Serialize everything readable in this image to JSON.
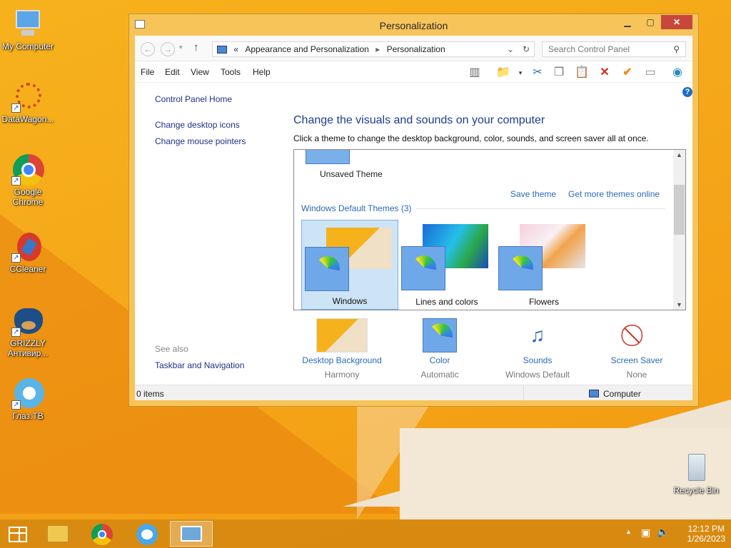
{
  "desktop": {
    "icons": [
      {
        "label": "My Computer"
      },
      {
        "label": "DataWagon..."
      },
      {
        "label": "Google Chrome"
      },
      {
        "label": "CCleaner"
      },
      {
        "label": "GRIZZLY Антивир..."
      },
      {
        "label": "Глаз.ТВ"
      },
      {
        "label": "Recycle Bin"
      }
    ]
  },
  "window": {
    "title": "Personalization",
    "breadcrumb": {
      "prefix": "«",
      "items": [
        "Appearance and Personalization",
        "Personalization"
      ]
    },
    "search_placeholder": "Search Control Panel",
    "menu": [
      "File",
      "Edit",
      "View",
      "Tools",
      "Help"
    ],
    "left_pane": {
      "home": "Control Panel Home",
      "links": [
        "Change desktop icons",
        "Change mouse pointers"
      ],
      "see_also_label": "See also",
      "see_also_links": [
        "Taskbar and Navigation"
      ]
    },
    "heading": "Change the visuals and sounds on your computer",
    "subheading": "Click a theme to change the desktop background, color, sounds, and screen saver all at once.",
    "unsaved_theme": "Unsaved Theme",
    "save_theme": "Save theme",
    "get_more": "Get more themes online",
    "default_themes_header": "Windows Default Themes (3)",
    "themes": [
      {
        "name": "Windows",
        "selected": true
      },
      {
        "name": "Lines and colors",
        "selected": false
      },
      {
        "name": "Flowers",
        "selected": false
      }
    ],
    "settings": [
      {
        "name": "Desktop Background",
        "value": "Harmony"
      },
      {
        "name": "Color",
        "value": "Automatic"
      },
      {
        "name": "Sounds",
        "value": "Windows Default"
      },
      {
        "name": "Screen Saver",
        "value": "None"
      }
    ],
    "status": {
      "items": "0 items",
      "location": "Computer"
    }
  },
  "taskbar": {
    "time": "12:12 PM",
    "date": "1/26/2023"
  }
}
